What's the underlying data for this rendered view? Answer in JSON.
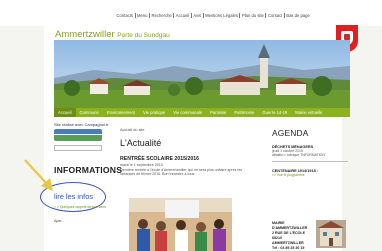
{
  "top_nav": {
    "links": [
      "Contacts",
      "Menu",
      "Recherche",
      "Accueil",
      "Avis",
      "Mentions Légales",
      "Plan du site",
      "Contact",
      "Bas de page"
    ]
  },
  "site": {
    "title": "Ammertzwiller",
    "subtitle": "Porte du Sundgau"
  },
  "main_nav": {
    "items": [
      "Accueil",
      "Commune",
      "Environnement",
      "Vie pratique",
      "Vie communale",
      "Paroisse",
      "Patrimoine",
      "Guerre 14-18",
      "Mairie virtuelle"
    ]
  },
  "sidebar_left": {
    "visit_text": "Site réalisé avec Campagnol.fr",
    "informations_heading": "INFORMATIONS",
    "lire_link": "lire les infos",
    "small_link": "> > Quelques rappels de bon sens",
    "more_text": "Aper..."
  },
  "main": {
    "breadcrumb": "Accueil du site",
    "heading": "L'Actualité",
    "article": {
      "title": "RENTRÉE SCOLAIRE 2015/2016",
      "date": "mardi le 1 septembre 2015",
      "text": "Dernière rentrée à l'école d'Ammertzwiller, qui ne sera plus unitaire après les vacances de février 2016. Bon trimestre à tous"
    }
  },
  "sidebar_right": {
    "agenda_heading": "AGENDA",
    "event1_title": "DÉCHETS MÉNAGERS",
    "event1_date": "jeudi 1 octobre 2015",
    "event1_link": "détails>> rubrique \"INFORMATION\"",
    "event2_title": "CENTENAIRE 1914/1918 :",
    "event2_link": ">> Voir le programme",
    "mairie_lines": [
      "MAIRIE D'AMMERTZWILLER",
      "2 RUE DE L'ÉCOLE",
      "68210 AMMERTZWILLER",
      "Tél : 03 89 25 30 15"
    ]
  },
  "colors": {
    "nav_green": "#8ab31e",
    "title_green": "#8aa020",
    "crest_red": "#e02020",
    "annotation_blue": "#3c59b8"
  }
}
